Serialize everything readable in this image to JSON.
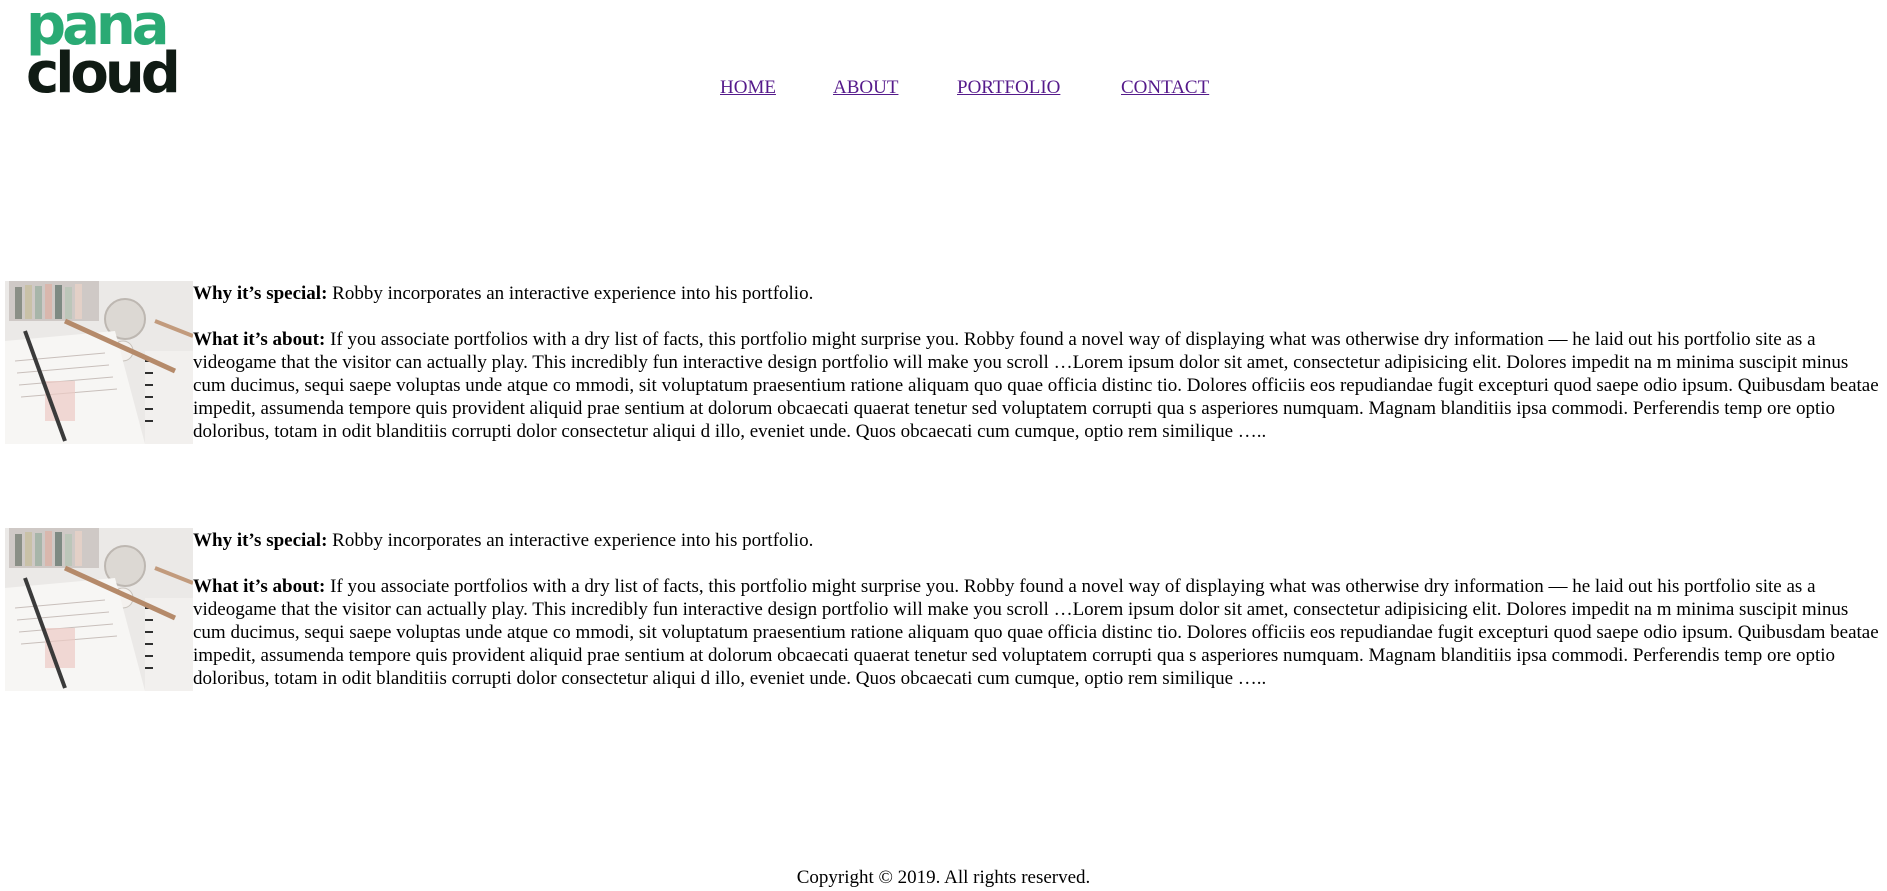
{
  "header": {
    "logo": {
      "line1": "pana",
      "line2": "cloud",
      "colors": {
        "top": "#2aaa74",
        "bottom": "#101b14"
      }
    },
    "nav": {
      "items": [
        {
          "label": "HOME"
        },
        {
          "label": "ABOUT"
        },
        {
          "label": "PORTFOLIO"
        },
        {
          "label": "CONTACT"
        }
      ],
      "link_color": "#551a8b"
    }
  },
  "articles": [
    {
      "image": "desk-stationery-photo",
      "special_label": "Why it’s special:",
      "special_text": " Robby incorporates an interactive experience into his portfolio.",
      "about_label": "What it’s about:",
      "about_text": " If you associate portfolios with a dry list of facts, this portfolio might surprise you. Robby found a novel way of displaying what was otherwise dry information — he laid out his portfolio site as a videogame that the visitor can actually play. This incredibly fun interactive design portfolio will make you scroll …Lorem ipsum dolor sit amet, consectetur adipisicing elit. Dolores impedit na m minima suscipit minus cum ducimus, sequi saepe voluptas unde atque co mmodi, sit voluptatum praesentium ratione aliquam quo quae officia distinc tio. Dolores officiis eos repudiandae fugit excepturi quod saepe odio ipsum. Quibusdam beatae impedit, assumenda tempore quis provident aliquid prae sentium at dolorum obcaecati quaerat tenetur sed voluptatem corrupti qua s asperiores numquam. Magnam blanditiis ipsa commodi. Perferendis temp ore optio doloribus, totam in odit blanditiis corrupti dolor consectetur aliqui d illo, eveniet unde. Quos obcaecati cum cumque, optio rem similique ….."
    },
    {
      "image": "desk-stationery-photo",
      "special_label": "Why it’s special:",
      "special_text": " Robby incorporates an interactive experience into his portfolio.",
      "about_label": "What it’s about:",
      "about_text": " If you associate portfolios with a dry list of facts, this portfolio might surprise you. Robby found a novel way of displaying what was otherwise dry information — he laid out his portfolio site as a videogame that the visitor can actually play. This incredibly fun interactive design portfolio will make you scroll …Lorem ipsum dolor sit amet, consectetur adipisicing elit. Dolores impedit na m minima suscipit minus cum ducimus, sequi saepe voluptas unde atque co mmodi, sit voluptatum praesentium ratione aliquam quo quae officia distinc tio. Dolores officiis eos repudiandae fugit excepturi quod saepe odio ipsum. Quibusdam beatae impedit, assumenda tempore quis provident aliquid prae sentium at dolorum obcaecati quaerat tenetur sed voluptatem corrupti qua s asperiores numquam. Magnam blanditiis ipsa commodi. Perferendis temp ore optio doloribus, totam in odit blanditiis corrupti dolor consectetur aliqui d illo, eveniet unde. Quos obcaecati cum cumque, optio rem similique ….."
    }
  ],
  "footer": {
    "copyright": "Copyright © 2019. All rights reserved."
  }
}
